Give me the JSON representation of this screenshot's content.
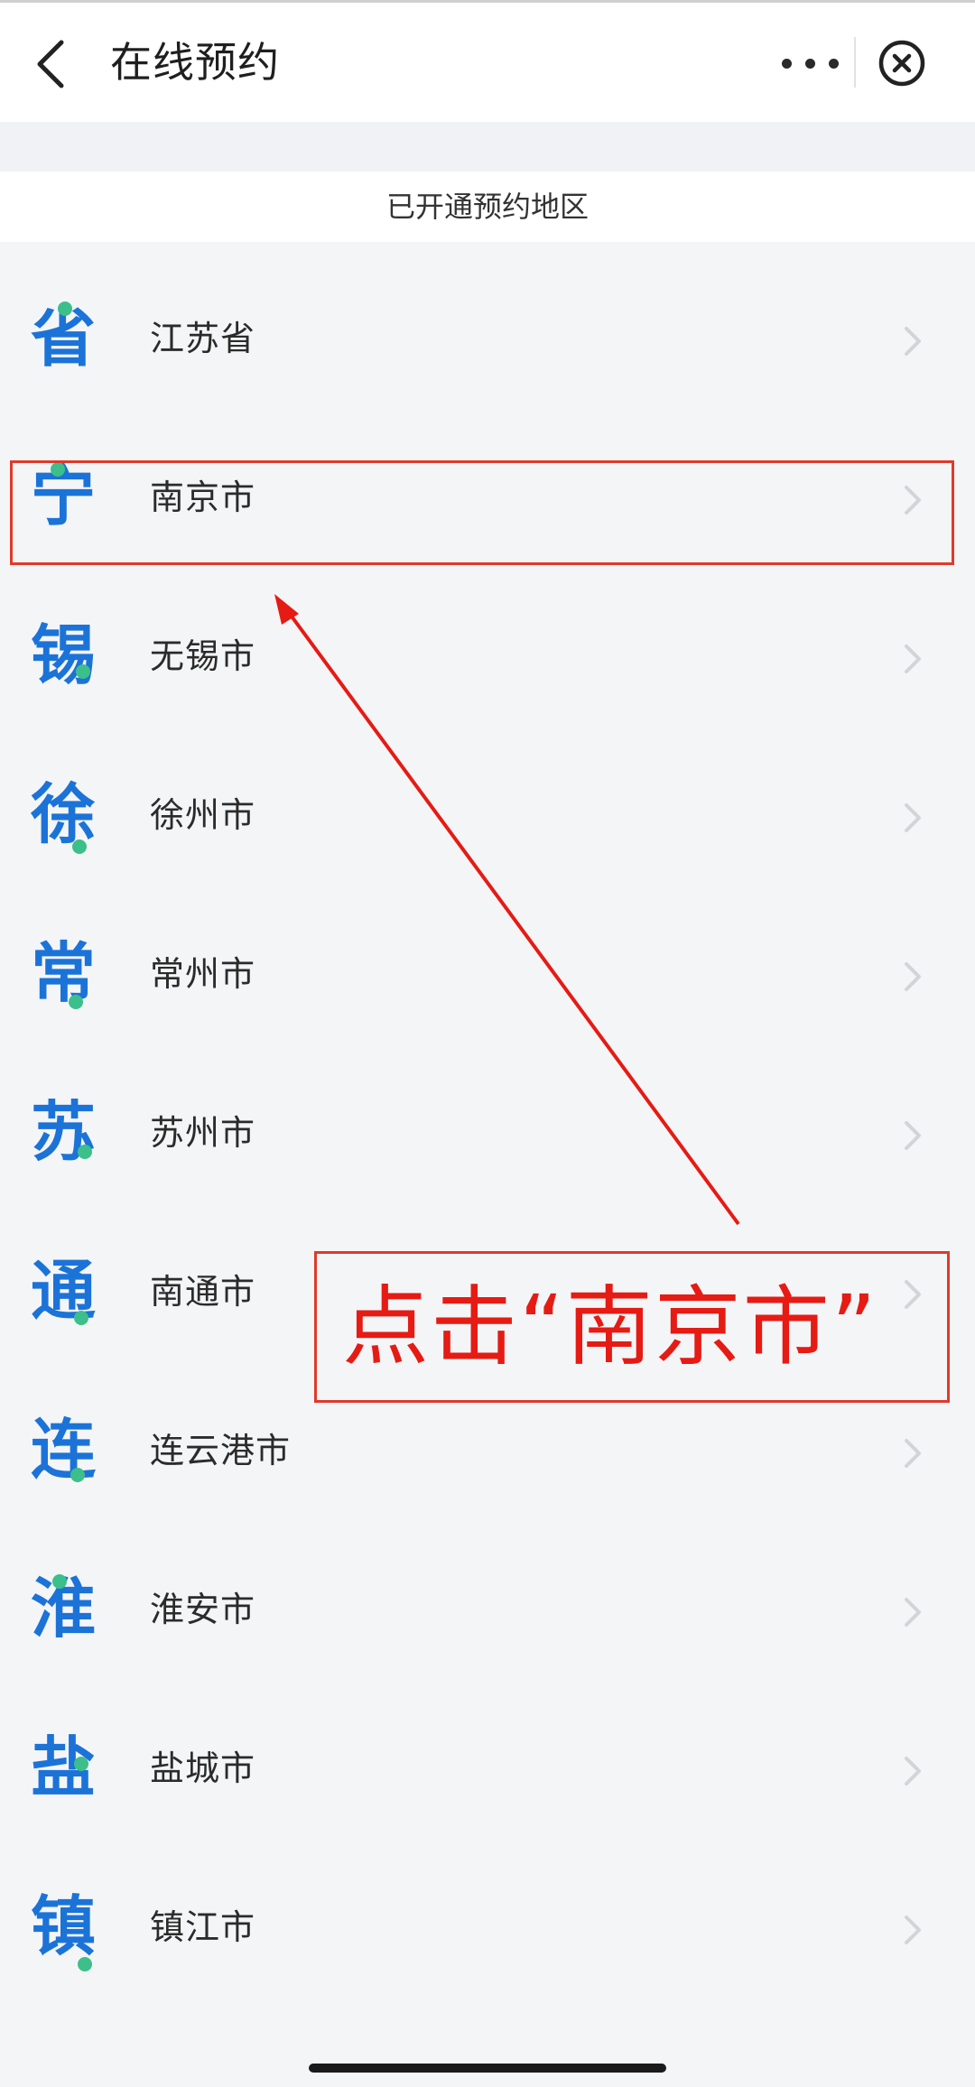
{
  "navbar": {
    "title": "在线预约",
    "back_icon": "chevron-left-icon",
    "more_icon": "more-dots-icon",
    "close_icon": "close-circle-icon"
  },
  "section_header": "已开通预约地区",
  "regions": [
    {
      "icon_char": "省",
      "label": "江苏省"
    },
    {
      "icon_char": "宁",
      "label": "南京市"
    },
    {
      "icon_char": "锡",
      "label": "无锡市"
    },
    {
      "icon_char": "徐",
      "label": "徐州市"
    },
    {
      "icon_char": "常",
      "label": "常州市"
    },
    {
      "icon_char": "苏",
      "label": "苏州市"
    },
    {
      "icon_char": "通",
      "label": "南通市"
    },
    {
      "icon_char": "连",
      "label": "连云港市"
    },
    {
      "icon_char": "淮",
      "label": "淮安市"
    },
    {
      "icon_char": "盐",
      "label": "盐城市"
    },
    {
      "icon_char": "镇",
      "label": "镇江市"
    }
  ],
  "annotation": {
    "text": "点击“南京市”",
    "color": "#e51b14"
  },
  "colors": {
    "icon_blue": "#1b73d8",
    "icon_dot_green": "#3cbf8a",
    "highlight_red": "#e03a2a"
  }
}
